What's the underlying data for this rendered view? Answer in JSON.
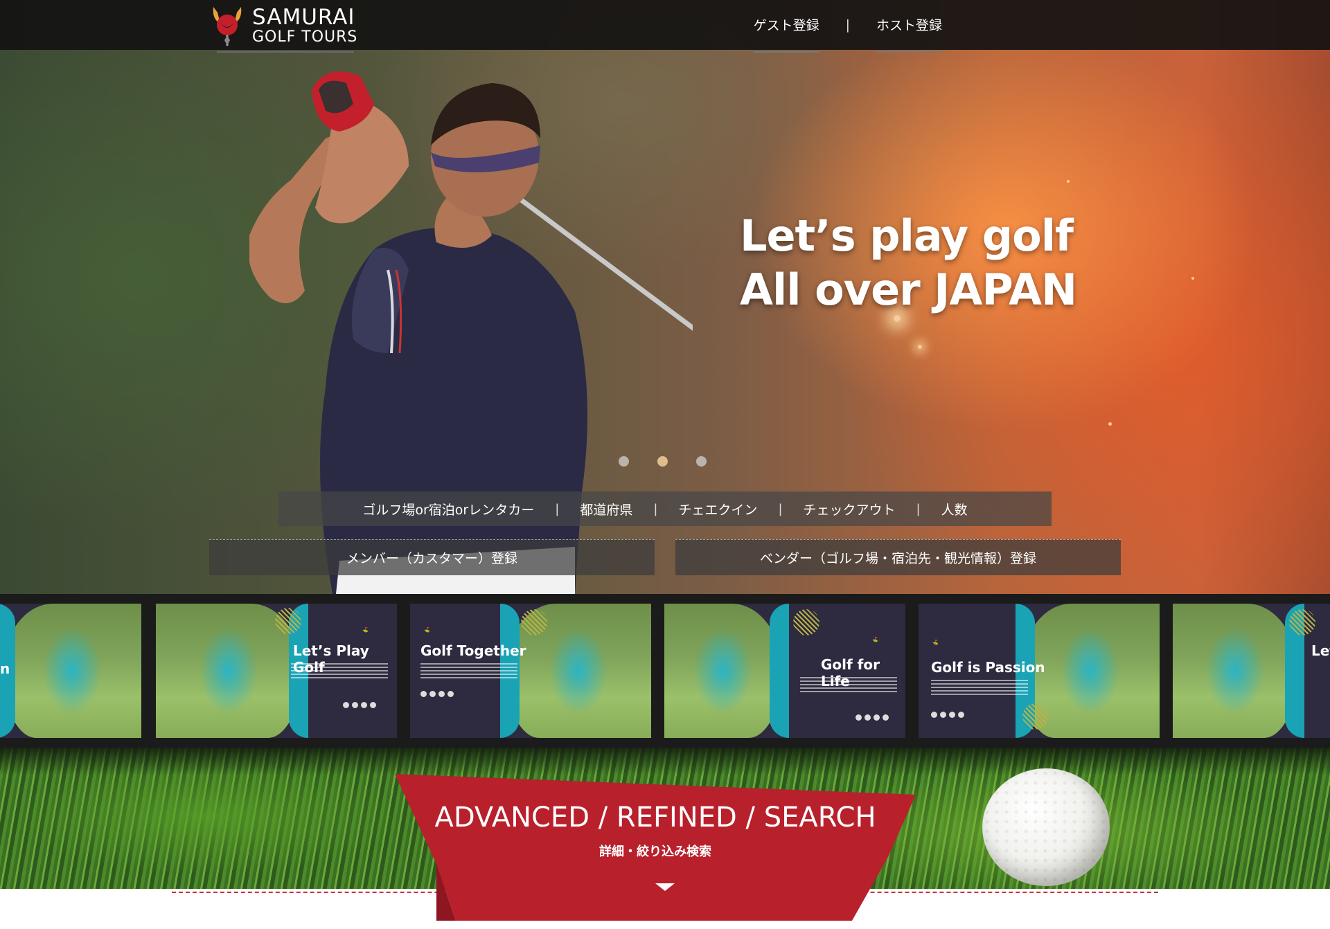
{
  "header": {
    "logo": {
      "line1": "SAMURAI",
      "line2": "GOLF TOURS"
    },
    "nav": [
      {
        "label": "ゲスト登録"
      },
      {
        "label": "ホスト登録"
      }
    ],
    "nav_separator": "|"
  },
  "hero": {
    "headline_line1": "Let’s play golf",
    "headline_line2": "All over JAPAN",
    "slide_count": 3,
    "active_slide": 2
  },
  "search": {
    "fields": [
      {
        "label": "ゴルフ場or宿泊orレンタカー"
      },
      {
        "label": "都道府県"
      },
      {
        "label": "チェエクイン"
      },
      {
        "label": "チェックアウト"
      },
      {
        "label": "人数"
      }
    ],
    "separator": "|"
  },
  "registration": {
    "member_label": "メンバー（カスタマー）登録",
    "vendor_label": "ベンダー（ゴルフ場・宿泊先・観光情報）登録"
  },
  "carousel": {
    "cards": [
      {
        "title": "n",
        "layout": "text-left"
      },
      {
        "title": "Let’s Play Golf",
        "layout": "text-right"
      },
      {
        "title": "Golf Together",
        "layout": "text-left"
      },
      {
        "title": "Golf for Life",
        "layout": "text-right"
      },
      {
        "title": "Golf is Passion",
        "layout": "text-left"
      },
      {
        "title": "Let",
        "layout": "text-right"
      }
    ]
  },
  "advanced": {
    "title": "ADVANCED / REFINED / SEARCH",
    "subtitle": "詳細・絞り込み検索"
  },
  "colors": {
    "brand_red": "#b8202c",
    "topbar": "#141212",
    "accent_teal": "#1aa3b5"
  }
}
